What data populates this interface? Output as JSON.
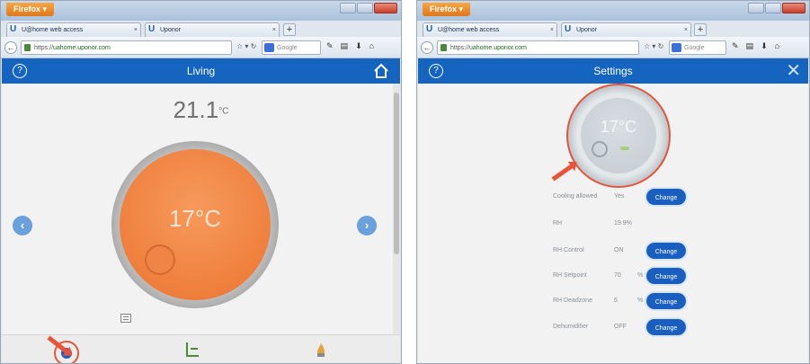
{
  "left": {
    "browser": {
      "menu_button": "Firefox ▾",
      "tabs": [
        {
          "label": "U@home web access"
        },
        {
          "label": "Uponor"
        }
      ],
      "url_prefix": "https://",
      "url_host": "uahome.uponor.com",
      "search_placeholder": "Google"
    },
    "app": {
      "header_title": "Living",
      "current_temp": "21.1",
      "current_temp_unit": "°C",
      "setpoint": "17°C",
      "help_icon": "?",
      "prev_arrow": "‹",
      "next_arrow": "›"
    }
  },
  "right": {
    "browser": {
      "menu_button": "Firefox ▾",
      "tabs": [
        {
          "label": "U@home web access"
        },
        {
          "label": "Uponor"
        }
      ],
      "url_prefix": "https://",
      "url_host": "uahome.uponor.com",
      "search_placeholder": "Google"
    },
    "app": {
      "header_title": "Settings",
      "help_icon": "?",
      "close_icon": "✕",
      "setpoint": "17°C",
      "rows": [
        {
          "label": "Cooling allowed",
          "value": "Yes",
          "unit": "",
          "button": "Change"
        },
        {
          "label": "RH",
          "value": "19.9%",
          "unit": "",
          "button": ""
        },
        {
          "label": "RH Control",
          "value": "ON",
          "unit": "",
          "button": "Change"
        },
        {
          "label": "RH Setpoint",
          "value": "70",
          "unit": "%",
          "button": "Change"
        },
        {
          "label": "RH Deadzone",
          "value": "5",
          "unit": "%",
          "button": "Change"
        },
        {
          "label": "Dehumidifier",
          "value": "OFF",
          "unit": "",
          "button": "Change"
        }
      ]
    }
  },
  "colors": {
    "header_blue": "#1565c0",
    "dial_orange": "#ef7f3d",
    "callout_red": "#e8543a",
    "button_blue": "#1a5fc0"
  }
}
